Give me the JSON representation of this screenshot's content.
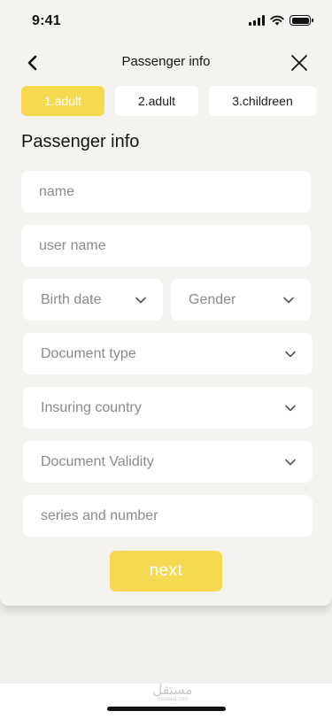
{
  "status_bar": {
    "time": "9:41"
  },
  "nav": {
    "title": "Passenger info"
  },
  "tabs": [
    {
      "label": "1.adult",
      "active": true
    },
    {
      "label": "2.adult",
      "active": false
    },
    {
      "label": "3.childreen",
      "active": false
    }
  ],
  "section_title": "Passenger info",
  "fields": {
    "name": {
      "placeholder": "name",
      "value": ""
    },
    "user_name": {
      "placeholder": "user name",
      "value": ""
    },
    "birth_date": {
      "placeholder": "Birth date"
    },
    "gender": {
      "placeholder": "Gender"
    },
    "document_type": {
      "placeholder": "Document type"
    },
    "insuring_country": {
      "placeholder": "Insuring country"
    },
    "document_validity": {
      "placeholder": "Document Validity"
    },
    "series_number": {
      "placeholder": "series and number",
      "value": ""
    }
  },
  "next_button": {
    "label": "next"
  },
  "watermark": {
    "arabic": "مستقل",
    "latin": "mostaql.com"
  },
  "colors": {
    "accent": "#f4d951",
    "background": "#f4f3f0",
    "field_bg": "#ffffff",
    "placeholder": "#8a8a8a"
  },
  "icons": [
    "signal-icon",
    "wifi-icon",
    "battery-icon",
    "back-arrow-icon",
    "close-icon",
    "chevron-down-icon"
  ]
}
